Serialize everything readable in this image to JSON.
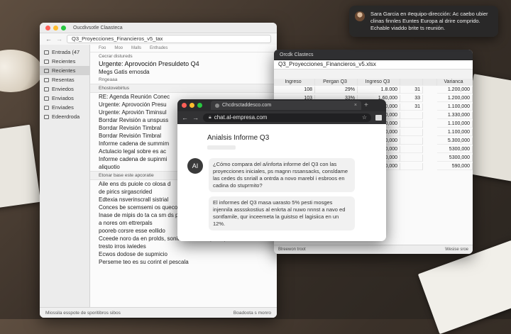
{
  "notification": {
    "text_lines": [
      "Sara Garcia en #equipo-dirección: Ac caebo ubier",
      "clinas finnles Euntes Europa al drire comprido.",
      "Echable viaddo brite ts reunión."
    ]
  },
  "mail": {
    "window_title": "Oucdivsotle Claasteca",
    "search_value": "Q3_Proyecciones_Financieros_v5_tax",
    "toolbar_tabs": [
      "Foo",
      "Moo",
      "Malls",
      "Enthades"
    ],
    "sidebar": [
      {
        "label": "Entrada (47",
        "active": false
      },
      {
        "label": "Recientes",
        "active": false
      },
      {
        "label": "Recientes",
        "active": true
      },
      {
        "label": "Resentas",
        "active": false
      },
      {
        "label": "Enviedos",
        "active": false
      },
      {
        "label": "Enviados",
        "active": false
      },
      {
        "label": "Enviades",
        "active": false
      },
      {
        "label": "Edeerdroda",
        "active": false
      }
    ],
    "rows": [
      {
        "text": "Cecrar distureds",
        "kind": "sub"
      },
      {
        "text": "Urgente: Aprovoción Presuldeto Q4",
        "kind": "lg"
      },
      {
        "text": "Megs Gatis ernosda",
        "kind": "norm"
      },
      {
        "text": "Rngeaaa",
        "kind": "sub"
      },
      {
        "text": "Ehostovebirtus",
        "kind": "sec"
      },
      {
        "text": "RE: Agenda Reunión Conec",
        "kind": "norm"
      },
      {
        "text": "Urgente: Aprovoción Presu",
        "kind": "norm"
      },
      {
        "text": "Urgente: Aprovión Timinsul",
        "kind": "norm"
      },
      {
        "text": "Borrdar Revisión a unspuss",
        "kind": "norm"
      },
      {
        "text": "Borrdar Revisión Timbral",
        "kind": "norm"
      },
      {
        "text": "Borrdar Revisión Timbral",
        "kind": "norm"
      },
      {
        "text": "Informe cadena de summim",
        "kind": "norm"
      },
      {
        "text": "Actulacio legal sobre es ac",
        "kind": "norm"
      },
      {
        "text": "Informe cadena de supinmi",
        "kind": "norm"
      },
      {
        "text": "aliquotio",
        "kind": "norm"
      },
      {
        "text": "Etonar base este apcoratie",
        "kind": "sec"
      },
      {
        "text": "Aile ens ds puiole co olosa d",
        "kind": "norm"
      },
      {
        "text": "de pirics sirgascrided",
        "kind": "norm"
      },
      {
        "text": "Edtexia nsverinscrall sistrial",
        "kind": "norm"
      },
      {
        "text": "Conces be scemsemi os quecoso",
        "kind": "norm"
      },
      {
        "text": "Inase de mipis do ta ca sm ds prequisición",
        "kind": "norm"
      },
      {
        "text": "a nores om ettrerpals",
        "kind": "norm"
      },
      {
        "text": "pooreb corsre esse eollido",
        "kind": "norm"
      },
      {
        "text": "Cceede noro da en prolds, sonita loed di en prasspeción",
        "kind": "norm"
      },
      {
        "text": "tresto irros iwiedes",
        "kind": "norm"
      },
      {
        "text": "Ecwos dodose de supmicio",
        "kind": "norm"
      },
      {
        "text": "Perseme teo es su corint el pescala",
        "kind": "norm"
      }
    ],
    "status_left": "Miossila esspote de sporitibros sibos",
    "status_right": "Boadoota s monro"
  },
  "sheet": {
    "window_title": "Orcdk Clastecs",
    "filename": "Q3_Proyecciones_Financieros_v5.xlsx",
    "headers": [
      "Ingreso",
      "Pergan Q3",
      "Ingreso Q3",
      "",
      "",
      "Varianca"
    ],
    "rows": [
      [
        "108",
        "29%",
        "1.8.000",
        "31",
        "1.200,000"
      ],
      [
        "103",
        "33%",
        "1.60,000",
        "33",
        "1.200,000"
      ],
      [
        "123",
        "20%",
        "1.60,000",
        "31",
        "1.100,000"
      ],
      [
        "",
        "",
        "1.80,000",
        "",
        "1.330,000"
      ],
      [
        "",
        "",
        "1.60,000",
        "",
        "1.100,000"
      ],
      [
        "",
        "",
        "1.50,000",
        "",
        "1.100,000"
      ],
      [
        "",
        "",
        "1.80,000",
        "",
        "5.300,000"
      ],
      [
        "",
        "",
        "1.50,000",
        "",
        "5300,000"
      ],
      [
        "",
        "",
        "1.20,000",
        "",
        "5300,000"
      ],
      [
        "",
        "",
        "1.90,000",
        "",
        "590,000"
      ]
    ],
    "status_left": "Blreewon troot",
    "status_right": "Wesise sroe"
  },
  "browser": {
    "tab_title": "Chcdrsctaddesco.com",
    "url": "chat.al-empresa.com",
    "page_title": "Anialsis Informe Q3",
    "avatar_label": "AI",
    "message_q": "¿Cómo compara del a/inforta informe del Q3 con las proyecciones iniciales, ps magnn rssansacks, consldame las cedes ds snriall a ontrda a novo marebl i esbroos en cadina do stuprmito?",
    "message_a": "El informes del Q3 masa uarasto 5% pesti mosges injennila asssskostius al enkrta al nuwo nnnst a navo ed sontfamile, qur inceemeta la guistso el lagisiica en un 12%."
  },
  "colors": {
    "mac_red": "#ff5f57",
    "mac_yellow": "#febc2e",
    "mac_green": "#28c840",
    "browser_chrome": "#2b2b2d",
    "notification_bg": "#282828"
  }
}
